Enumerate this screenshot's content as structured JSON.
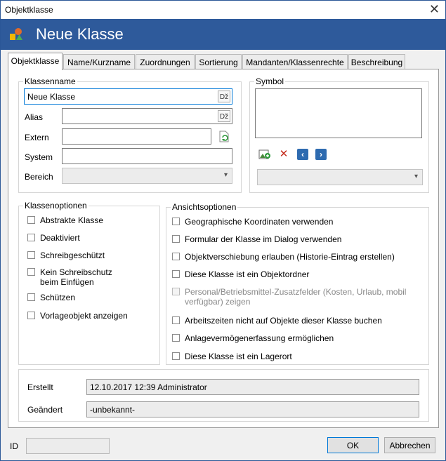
{
  "window": {
    "title": "Objektklasse",
    "close": "✕"
  },
  "header": {
    "title": "Neue Klasse"
  },
  "tabs": [
    "Objektklasse",
    "Name/Kurzname",
    "Zuordnungen",
    "Sortierung",
    "Mandanten/Klassenrechte",
    "Beschreibung"
  ],
  "klassenname": {
    "group_label": "Klassenname",
    "name_value": "Neue Klasse",
    "alias_label": "Alias",
    "alias_value": "",
    "extern_label": "Extern",
    "extern_value": "",
    "system_label": "System",
    "system_value": "",
    "bereich_label": "Bereich",
    "bereich_value": ""
  },
  "symbol": {
    "group_label": "Symbol",
    "select_value": ""
  },
  "klassenoptionen": {
    "group_label": "Klassenoptionen",
    "items": [
      "Abstrakte Klasse",
      "Deaktiviert",
      "Schreibgeschützt",
      "Kein Schreibschutz",
      "Schützen",
      "Vorlageobjekt anzeigen"
    ],
    "item3_line2": "beim Einfügen"
  },
  "ansichtsoptionen": {
    "group_label": "Ansichtsoptionen",
    "items": [
      "Geographische Koordinaten verwenden",
      "Formular der Klasse im Dialog verwenden",
      "Objektverschiebung erlauben (Historie-Eintrag erstellen)",
      "Diese Klasse ist ein Objektordner",
      "Personal/Betriebsmittel-Zusatzfelder (Kosten, Urlaub, mobil",
      "Arbeitszeiten nicht auf Objekte dieser Klasse buchen",
      "Anlagevermögenerfassung ermöglichen",
      "Diese Klasse ist ein Lagerort"
    ],
    "item4_line2": "verfügbar) zeigen"
  },
  "audit": {
    "erstellt_label": "Erstellt",
    "erstellt_value": "12.10.2017 12:39 Administrator",
    "geaendert_label": "Geändert",
    "geaendert_value": "-unbekannt-"
  },
  "footer": {
    "id_label": "ID",
    "id_value": "",
    "ok_label": "OK",
    "cancel_label": "Abbrechen"
  },
  "icons": {
    "close": "close-icon",
    "app": "class-icon",
    "lang": "translate-icon",
    "refresh": "refresh-icon",
    "add_symbol": "add-image-icon",
    "delete": "delete-icon",
    "prev": "arrow-left-icon",
    "next": "arrow-right-icon",
    "chevron": "chevron-down-icon"
  },
  "colors": {
    "header": "#2e5a9b",
    "accent": "#0078d7",
    "delete": "#c42b1c",
    "nav": "#2e6bb0"
  }
}
